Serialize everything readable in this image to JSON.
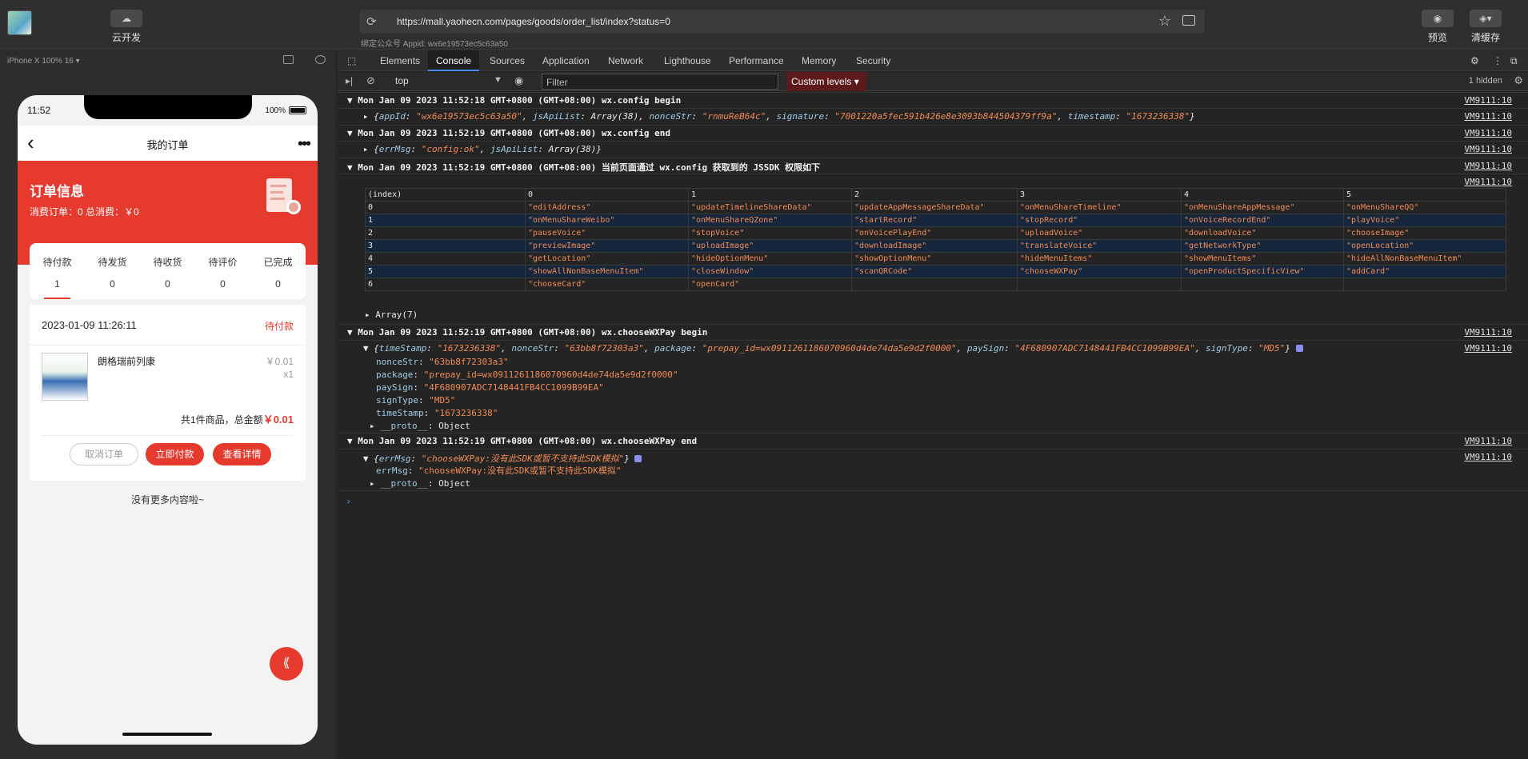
{
  "topbar": {
    "cloud_label": "云开发",
    "url": "https://mall.yaohecn.com/pages/goods/order_list/index?status=0",
    "appid_text": "绑定公众号 Appid: wx6e19573ec5c63a50",
    "preview_label": "预览",
    "clear_cache_label": "清缓存"
  },
  "simulator": {
    "device_label": "iPhone X 100% 16 ▾",
    "time": "11:52",
    "battery": "100%",
    "nav_title": "我的订单",
    "header_title": "订单信息",
    "header_sub": "消费订单：0  总消费：￥0",
    "tabs": [
      {
        "label": "待付款",
        "count": "1"
      },
      {
        "label": "待发货",
        "count": "0"
      },
      {
        "label": "待收货",
        "count": "0"
      },
      {
        "label": "待评价",
        "count": "0"
      },
      {
        "label": "已完成",
        "count": "0"
      }
    ],
    "order": {
      "date": "2023-01-09 11:26:11",
      "status": "待付款",
      "product_name": "朗格瑞前列康",
      "price": "￥0.01",
      "qty": "x1",
      "total_prefix": "共1件商品，总金额",
      "total_amount": "￥0.01",
      "btn_cancel": "取消订单",
      "btn_pay": "立即付款",
      "btn_detail": "查看详情"
    },
    "no_more": "没有更多内容啦~"
  },
  "devtools": {
    "tabs": [
      "Elements",
      "Console",
      "Sources",
      "Application",
      "Network",
      "Lighthouse",
      "Performance",
      "Memory",
      "Security"
    ],
    "active_tab": "Console",
    "context": "top",
    "filter_placeholder": "Filter",
    "levels": "Custom levels ▾",
    "hidden": "1 hidden",
    "source": "VM9111:10",
    "log1": "Mon Jan 09 2023 11:52:18 GMT+0800 (GMT+08:00) wx.config begin",
    "log2": "Mon Jan 09 2023 11:52:19 GMT+0800 (GMT+08:00) wx.config end",
    "log3": "Mon Jan 09 2023 11:52:19 GMT+0800 (GMT+08:00) 当前页面通过 wx.config 获取到的 JSSDK 权限如下",
    "log4": "Mon Jan 09 2023 11:52:19 GMT+0800 (GMT+08:00) wx.chooseWXPay begin",
    "log5": "Mon Jan 09 2023 11:52:19 GMT+0800 (GMT+08:00) wx.chooseWXPay end",
    "array_label": "Array(7)",
    "table_header": [
      "(index)",
      "0",
      "1",
      "2",
      "3",
      "4",
      "5"
    ],
    "table_rows": [
      [
        "0",
        "\"editAddress\"",
        "\"updateTimelineShareData\"",
        "\"updateAppMessageShareData\"",
        "\"onMenuShareTimeline\"",
        "\"onMenuShareAppMessage\"",
        "\"onMenuShareQQ\""
      ],
      [
        "1",
        "\"onMenuShareWeibo\"",
        "\"onMenuShareQZone\"",
        "\"startRecord\"",
        "\"stopRecord\"",
        "\"onVoiceRecordEnd\"",
        "\"playVoice\""
      ],
      [
        "2",
        "\"pauseVoice\"",
        "\"stopVoice\"",
        "\"onVoicePlayEnd\"",
        "\"uploadVoice\"",
        "\"downloadVoice\"",
        "\"chooseImage\""
      ],
      [
        "3",
        "\"previewImage\"",
        "\"uploadImage\"",
        "\"downloadImage\"",
        "\"translateVoice\"",
        "\"getNetworkType\"",
        "\"openLocation\""
      ],
      [
        "4",
        "\"getLocation\"",
        "\"hideOptionMenu\"",
        "\"showOptionMenu\"",
        "\"hideMenuItems\"",
        "\"showMenuItems\"",
        "\"hideAllNonBaseMenuItem\""
      ],
      [
        "5",
        "\"showAllNonBaseMenuItem\"",
        "\"closeWindow\"",
        "\"scanQRCode\"",
        "\"chooseWXPay\"",
        "\"openProductSpecificView\"",
        "\"addCard\""
      ],
      [
        "6",
        "\"chooseCard\"",
        "\"openCard\"",
        "",
        "",
        "",
        ""
      ]
    ],
    "pay": {
      "nonceStr": "\"63bb8f72303a3\"",
      "package": "\"prepay_id=wx091126118607096 0d4de74da5e9d2f0000\"",
      "paySign": "\"4F680907ADC7148441FB4CC1099B99EA\"",
      "signType": "\"MD5\"",
      "timeStamp": "\"1673236338\"",
      "proto": "Object"
    },
    "err": {
      "errMsg": "\"chooseWXPay:没有此SDK或暂不支持此SDK模拟\"",
      "proto": "Object"
    }
  }
}
